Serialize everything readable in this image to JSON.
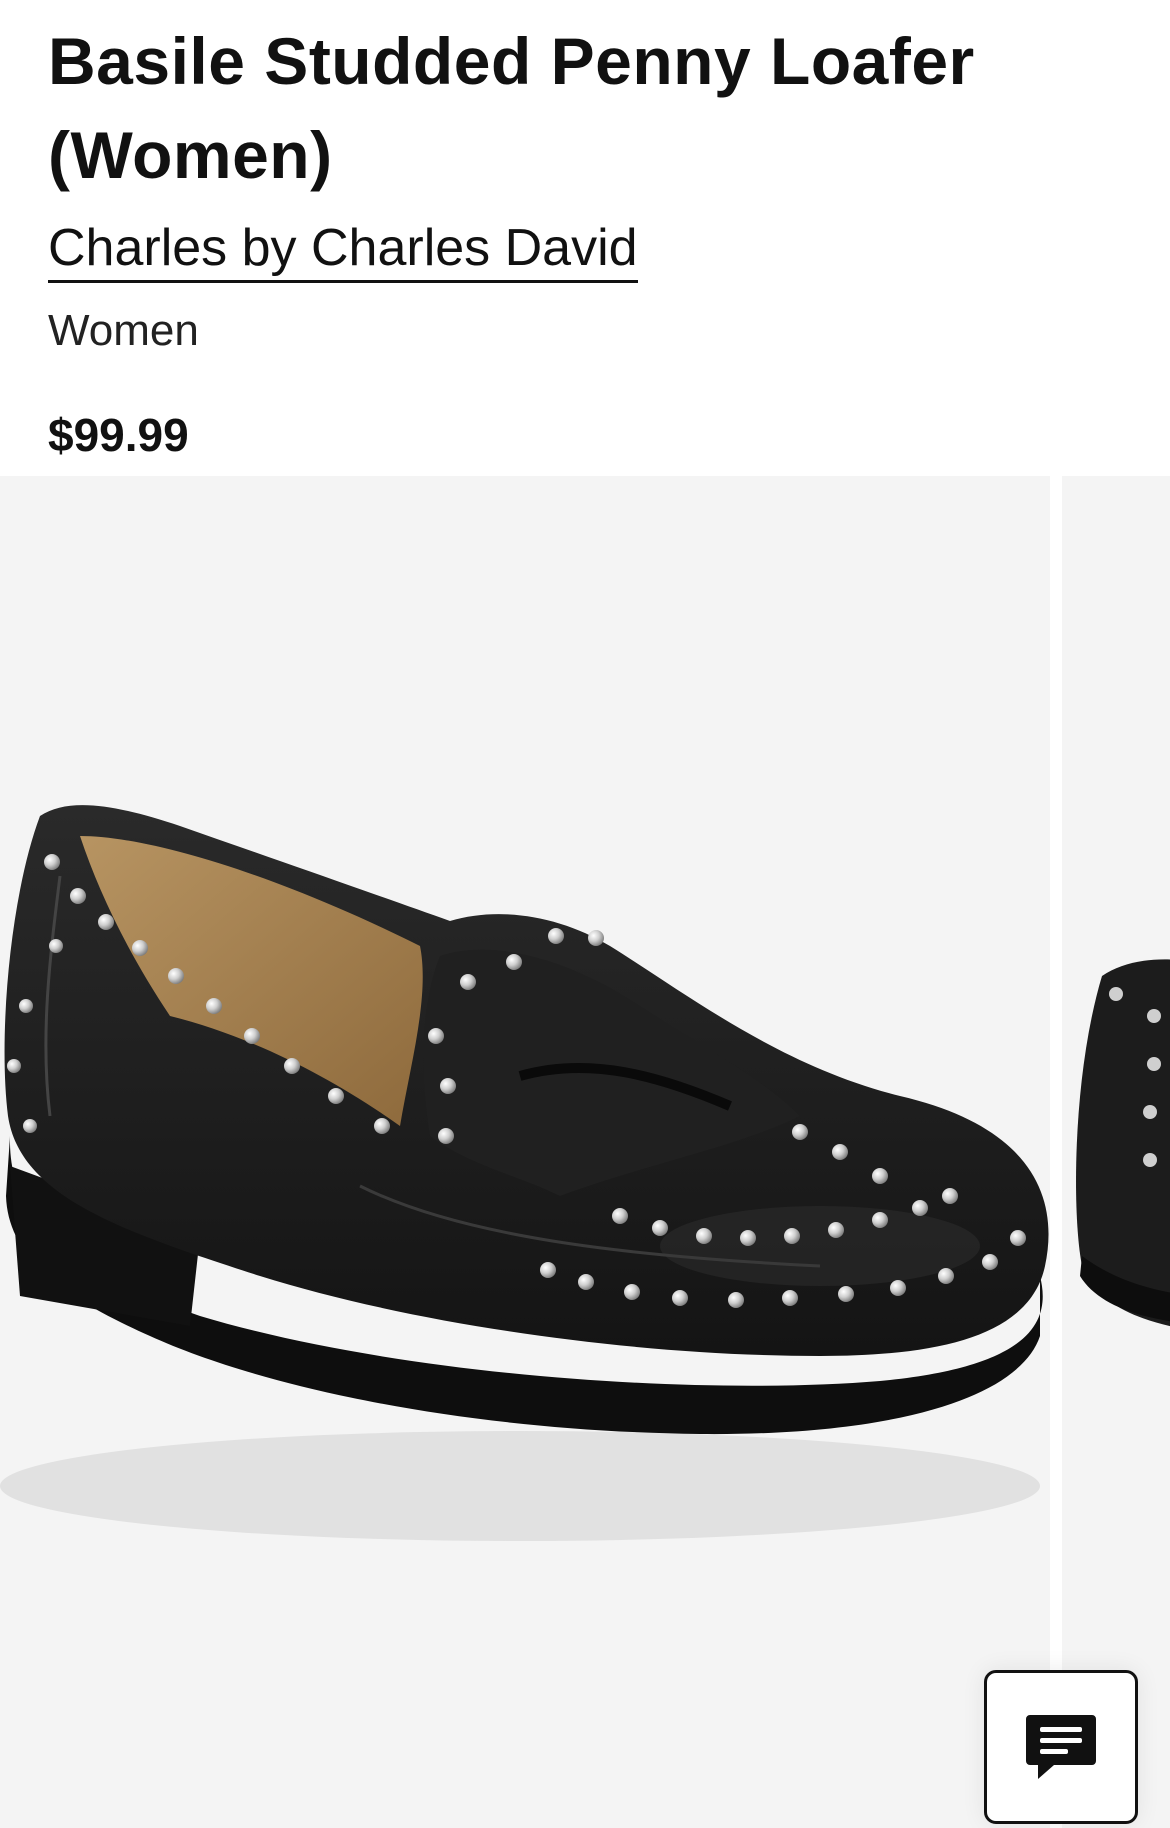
{
  "product": {
    "title": "Basile Studded Penny Loafer (Women)",
    "brand": "Charles by Charles David",
    "department": "Women",
    "price": "$99.99"
  },
  "gallery": {
    "main_image": "black-studded-penny-loafer",
    "next_image": "black-studded-penny-loafer-side-view"
  },
  "chat": {
    "icon": "chat-message-icon"
  },
  "colors": {
    "text": "#111111",
    "image_background": "#f4f4f4",
    "shoe": "#1c1c1c",
    "stud": "#c8c8c8"
  }
}
